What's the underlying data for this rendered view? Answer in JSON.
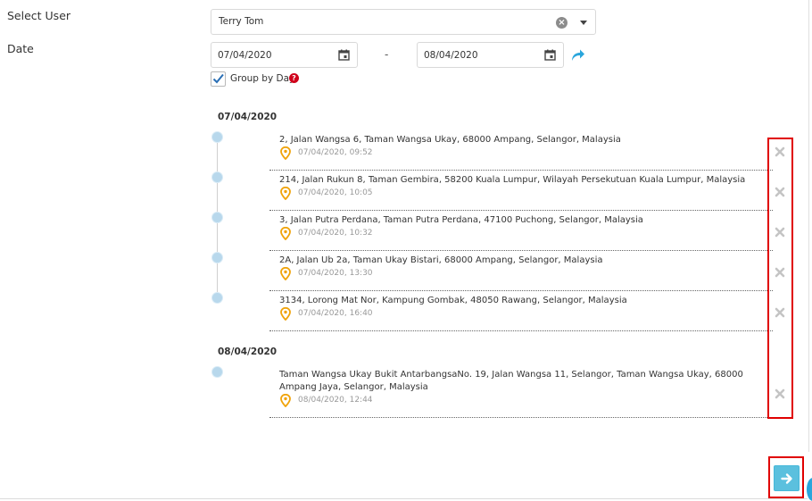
{
  "form": {
    "select_user_label": "Select User",
    "selected_user": "Terry Tom",
    "date_label": "Date",
    "date_from": "07/04/2020",
    "date_separator": "-",
    "date_to": "08/04/2020",
    "group_by_day_label": "Group by Day",
    "group_by_day_checked": true,
    "help_glyph": "?"
  },
  "days": [
    {
      "date": "07/04/2020",
      "entries": [
        {
          "address": "2, Jalan Wangsa 6, Taman Wangsa Ukay, 68000 Ampang, Selangor, Malaysia",
          "time": "07/04/2020, 09:52"
        },
        {
          "address": "214, Jalan Rukun 8, Taman Gembira, 58200 Kuala Lumpur, Wilayah Persekutuan Kuala Lumpur, Malaysia",
          "time": "07/04/2020, 10:05"
        },
        {
          "address": "3, Jalan Putra Perdana, Taman Putra Perdana, 47100 Puchong, Selangor, Malaysia",
          "time": "07/04/2020, 10:32"
        },
        {
          "address": "2A, Jalan Ub 2a, Taman Ukay Bistari, 68000 Ampang, Selangor, Malaysia",
          "time": "07/04/2020, 13:30"
        },
        {
          "address": "3134, Lorong Mat Nor, Kampung Gombak, 48050 Rawang, Selangor, Malaysia",
          "time": "07/04/2020, 16:40"
        }
      ]
    },
    {
      "date": "08/04/2020",
      "entries": [
        {
          "address": "Taman Wangsa Ukay Bukit AntarbangsaNo. 19, Jalan Wangsa 11, Selangor, Taman Wangsa Ukay, 68000 Ampang Jaya, Selangor, Malaysia",
          "time": "08/04/2020, 12:44"
        }
      ]
    }
  ],
  "icons": {
    "clear": "clear-icon",
    "dropdown": "caret-down-icon",
    "calendar": "calendar-icon",
    "refresh": "redo-arrow-icon",
    "check": "checkmark-icon",
    "help": "question-circle-icon",
    "location": "map-pin-icon",
    "delete": "x-icon",
    "next": "arrow-right-icon"
  },
  "colors": {
    "accent": "#5bc0de",
    "pin": "#f0a30a",
    "highlight": "#e00000",
    "timeline_dot": "#b8d8ec"
  }
}
